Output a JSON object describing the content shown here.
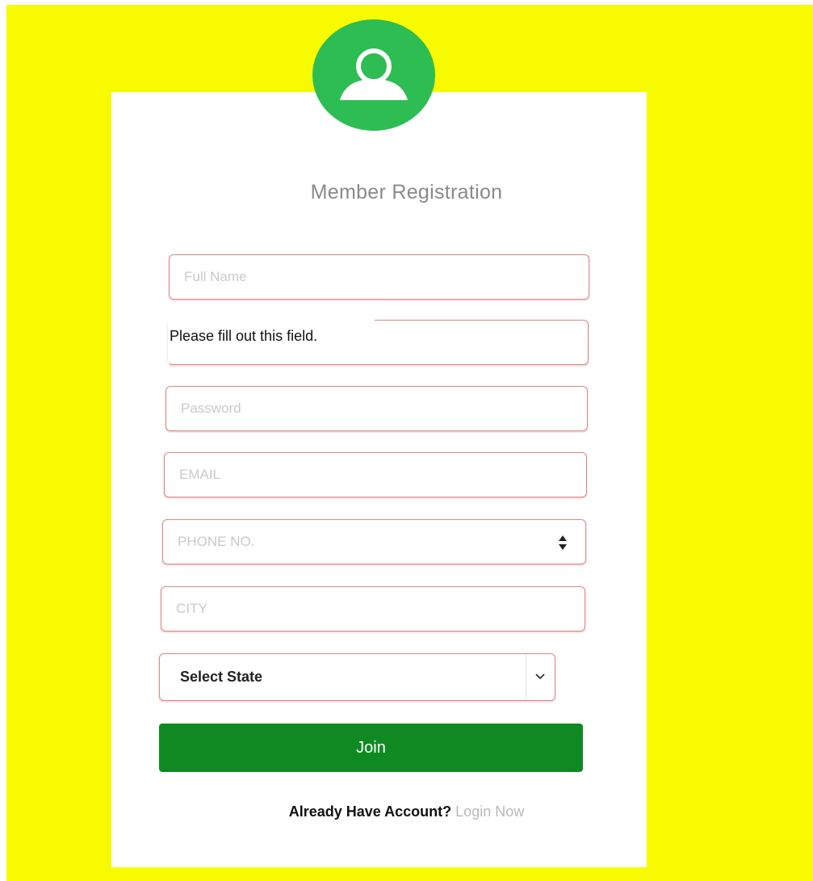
{
  "form": {
    "title": "Member Registration",
    "fields": {
      "full_name": {
        "placeholder": "Full Name",
        "value": ""
      },
      "second": {
        "placeholder": "",
        "value": ""
      },
      "password": {
        "placeholder": "Password",
        "value": ""
      },
      "email": {
        "placeholder": "EMAIL",
        "value": ""
      },
      "phone": {
        "placeholder": "PHONE NO.",
        "value": ""
      },
      "city": {
        "placeholder": "CITY",
        "value": ""
      }
    },
    "validation_tooltip": "Please fill out this field.",
    "state_select": {
      "selected": "Select State"
    },
    "join_label": "Join",
    "footer": {
      "question": "Already Have Account?",
      "login_link": "Login Now"
    }
  },
  "icons": {
    "avatar": "user-icon",
    "phone_spinner": "spinner-arrows-icon",
    "select_chevron": "chevron-down-icon"
  },
  "colors": {
    "background": "#f8fb00",
    "avatar": "#2ebd52",
    "button": "#0f8a23",
    "field_border": "#d98a8a"
  }
}
